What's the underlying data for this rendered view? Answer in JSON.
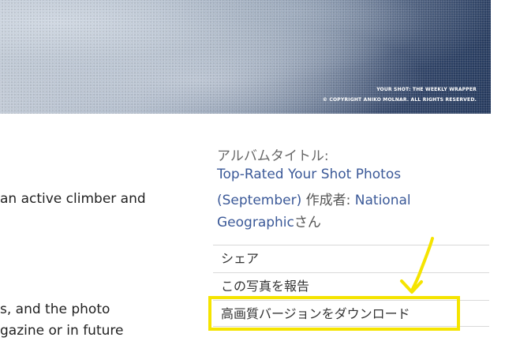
{
  "photo": {
    "credit_line_1": "YOUR SHOT: THE WEEKLY WRAPPER",
    "credit_line_2": "© COPYRIGHT ANIKO MOLNAR. ALL RIGHTS RESERVED."
  },
  "description": {
    "fragment_1": "an active climber and",
    "fragment_2": "s, and the photo",
    "fragment_3": "gazine or in future"
  },
  "sidebar": {
    "album_title_label": "アルバムタイトル:",
    "album_name_line_1": "Top-Rated Your Shot Photos",
    "album_name_line_2": "(September)",
    "created_by_label": " 作成者: ",
    "creator_line_1": "National",
    "creator_line_2": "Geographic",
    "creator_suffix": "さん",
    "actions": [
      {
        "label": "シェア"
      },
      {
        "label": "この写真を報告"
      },
      {
        "label": "高画質バージョンをダウンロード"
      }
    ]
  },
  "annotation": {
    "highlight_color": "#f5e400",
    "arrow_color": "#f5e400"
  }
}
